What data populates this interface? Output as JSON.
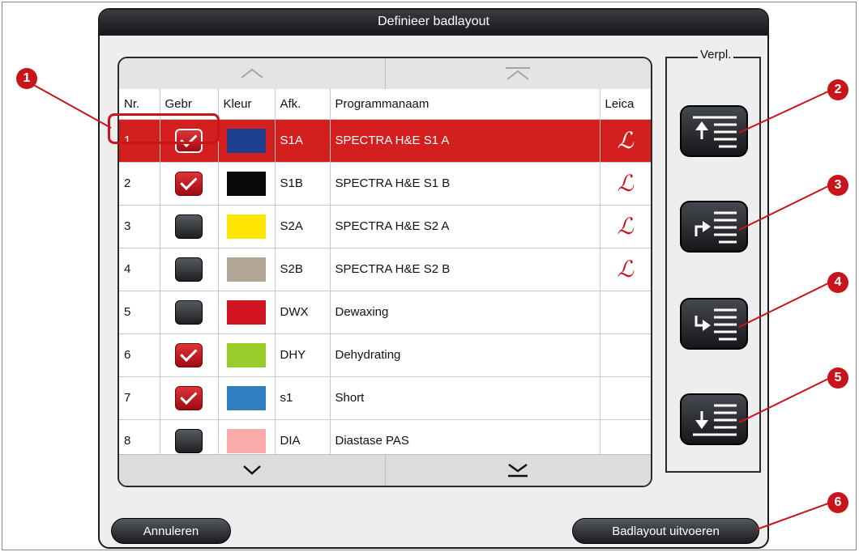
{
  "dialog": {
    "title": "Definieer badlayout"
  },
  "table": {
    "columns": [
      "Nr.",
      "Gebr",
      "Kleur",
      "Afk.",
      "Programmanaam",
      "Leica"
    ],
    "rows": [
      {
        "nr": "1",
        "used": true,
        "color": "#1e3f8e",
        "abbr": "S1A",
        "name": "SPECTRA H&E S1 A",
        "leica": "ℒ",
        "selected": true
      },
      {
        "nr": "2",
        "used": true,
        "color": "#0a0a0a",
        "abbr": "S1B",
        "name": "SPECTRA H&E S1 B",
        "leica": "ℒ",
        "selected": false
      },
      {
        "nr": "3",
        "used": false,
        "color": "#ffe500",
        "abbr": "S2A",
        "name": "SPECTRA H&E S2 A",
        "leica": "ℒ",
        "selected": false
      },
      {
        "nr": "4",
        "used": false,
        "color": "#b3a697",
        "abbr": "S2B",
        "name": "SPECTRA H&E S2 B",
        "leica": "ℒ",
        "selected": false
      },
      {
        "nr": "5",
        "used": false,
        "color": "#d31521",
        "abbr": "DWX",
        "name": "Dewaxing",
        "leica": "",
        "selected": false
      },
      {
        "nr": "6",
        "used": true,
        "color": "#99cc2a",
        "abbr": "DHY",
        "name": "Dehydrating",
        "leica": "",
        "selected": false
      },
      {
        "nr": "7",
        "used": true,
        "color": "#2f7fc1",
        "abbr": "s1",
        "name": "Short",
        "leica": "",
        "selected": false
      },
      {
        "nr": "8",
        "used": false,
        "color": "#fbaaaa",
        "abbr": "DIA",
        "name": "Diastase PAS",
        "leica": "",
        "selected": false
      }
    ]
  },
  "move_panel": {
    "label": "Verpl.",
    "buttons": [
      "move-to-top-icon",
      "move-up-icon",
      "move-down-icon",
      "move-to-bottom-icon"
    ]
  },
  "footer": {
    "cancel_label": "Annuleren",
    "execute_label": "Badlayout uitvoeren"
  },
  "callouts": [
    "1",
    "2",
    "3",
    "4",
    "5",
    "6"
  ],
  "colors": {
    "accent": "#c8141a",
    "selected_row": "#d41f1f",
    "button_dark": "#1f2023"
  }
}
